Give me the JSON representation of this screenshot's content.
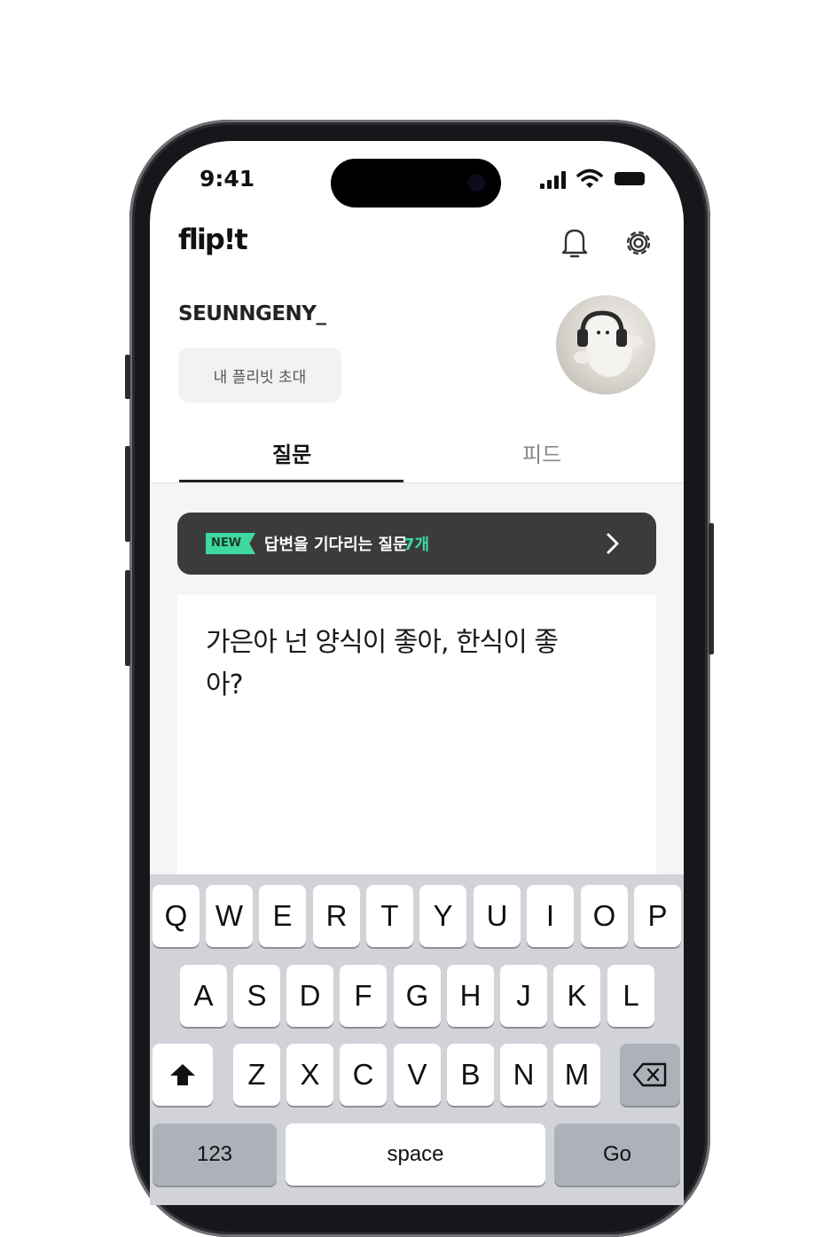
{
  "status_bar": {
    "time": "9:41"
  },
  "header": {
    "logo": "flip!t",
    "notifications_icon": "bell-icon",
    "settings_icon": "gear-icon"
  },
  "profile": {
    "username": "SEUNNGENY_",
    "invite_label": "내 플리빗 초대"
  },
  "tabs": [
    {
      "label": "질문",
      "active": true
    },
    {
      "label": "피드",
      "active": false
    }
  ],
  "banner": {
    "badge": "NEW",
    "text": "답변을 기다리는 질문",
    "count": "7개"
  },
  "question": {
    "line1": "가은아 넌 양식이 좋아, 한식이 좋",
    "line2": "아?"
  },
  "keyboard": {
    "row1": [
      "Q",
      "W",
      "E",
      "R",
      "T",
      "Y",
      "U",
      "I",
      "O",
      "P"
    ],
    "row2": [
      "A",
      "S",
      "D",
      "F",
      "G",
      "H",
      "J",
      "K",
      "L"
    ],
    "row3": [
      "Z",
      "X",
      "C",
      "V",
      "B",
      "N",
      "M"
    ],
    "numbers_label": "123",
    "space_label": "space",
    "go_label": "Go"
  },
  "colors": {
    "accent": "#3fd9a0",
    "banner_bg": "#3b3b3b",
    "keyboard_bg": "#d1d3d9"
  }
}
